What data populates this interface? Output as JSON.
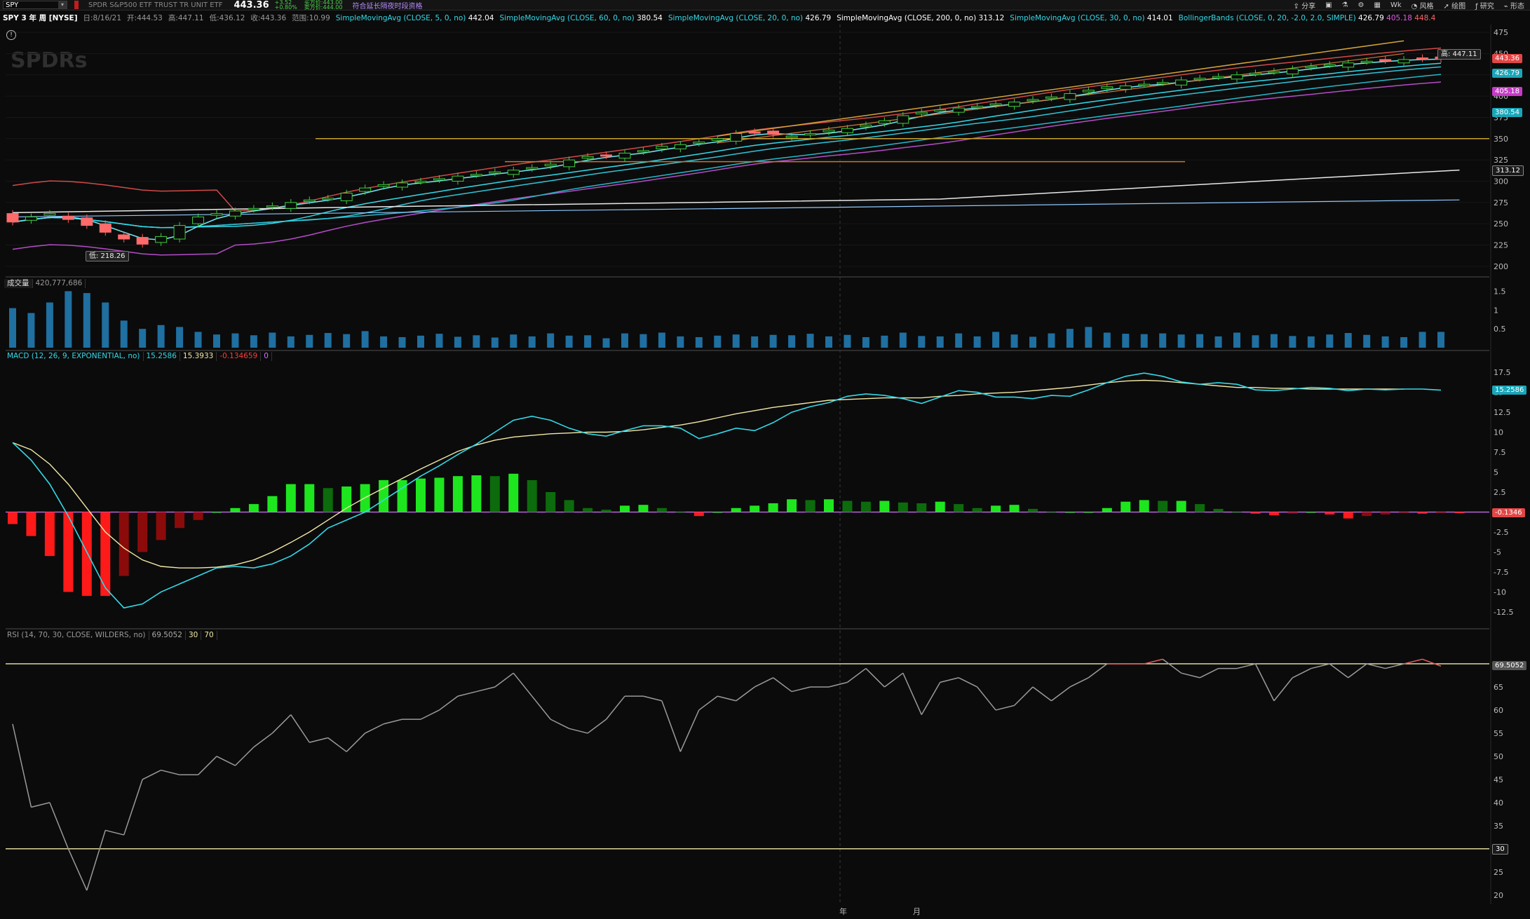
{
  "topbar": {
    "symbol": "SPY",
    "description": "SPDR S&P500 ETF TRUST TR UNIT ETF",
    "last": "443.36",
    "change": "+3.52",
    "change_pct": "+0.80%",
    "bid": "买方价:443.00",
    "ask": "卖方价:444.00",
    "extended": "符合延长隔夜时段资格",
    "menu": [
      "分享",
      "风格",
      "绘图",
      "研究",
      "形态"
    ]
  },
  "studybar": {
    "title": "SPY 3 年 周 [NYSE]",
    "date": "日:8/16/21",
    "open": "开:444.53",
    "high": "高:447.11",
    "low": "低:436.12",
    "close": "收:443.36",
    "range": "范围:10.99",
    "studies": [
      {
        "name": "SimpleMovingAvg (CLOSE, 5, 0, no)",
        "value": "442.04",
        "color": "#33d9e8"
      },
      {
        "name": "SimpleMovingAvg (CLOSE, 60, 0, no)",
        "value": "380.54",
        "color": "#33d9e8"
      },
      {
        "name": "SimpleMovingAvg (CLOSE, 20, 0, no)",
        "value": "426.79",
        "color": "#33d9e8"
      },
      {
        "name": "SimpleMovingAvg (CLOSE, 200, 0, no)",
        "value": "313.12",
        "color": "#ffffff"
      },
      {
        "name": "SimpleMovingAvg (CLOSE, 30, 0, no)",
        "value": "414.01",
        "color": "#33d9e8"
      },
      {
        "name": "BollingerBands (CLOSE, 0, 20, -2.0, 2.0, SIMPLE)",
        "value": "426.79",
        "value2": "405.18",
        "value3": "448.4",
        "color": "#33d9e8"
      }
    ]
  },
  "watermark": "SPDRs",
  "annotations": {
    "high": "高: 447.11",
    "low": "低: 218.26"
  },
  "price_axis": {
    "ticks": [
      "475",
      "450",
      "425",
      "400",
      "375",
      "350",
      "325",
      "300",
      "275",
      "250",
      "225",
      "200"
    ],
    "boxes": [
      {
        "text": "443.36",
        "value": 443.36,
        "bg": "#e24646"
      },
      {
        "text": "426.79",
        "value": 426.79,
        "bg": "#1aa6b8"
      },
      {
        "text": "405.18",
        "value": 405.18,
        "bg": "#c63bc6"
      },
      {
        "text": "380.54",
        "value": 380.54,
        "bg": "#1aa6b8"
      },
      {
        "text": "313.12",
        "value": 313.12,
        "bg": "#1a1a1a"
      }
    ]
  },
  "volume": {
    "label": "成交量",
    "value": "420,777,686",
    "ticks": [
      "1.5",
      "1",
      "0.5"
    ]
  },
  "macd": {
    "label": "MACD (12, 26, 9, EXPONENTIAL, no)",
    "v1": "15.2586",
    "v2": "15.3933",
    "v3": "-0.134659",
    "v4": "0",
    "ticks": [
      "17.5",
      "15",
      "12.5",
      "10",
      "7.5",
      "5",
      "2.5",
      "0",
      "-2.5",
      "-5",
      "-7.5",
      "-10",
      "-12.5"
    ],
    "boxes": [
      {
        "text": "15.2586",
        "value": 15.2586,
        "bg": "#1aa6b8"
      },
      {
        "text": "-0.1346",
        "value": -0.1346,
        "bg": "#e24646"
      }
    ]
  },
  "rsi": {
    "label": "RSI (14, 70, 30, CLOSE, WILDERS, no)",
    "v1": "69.5052",
    "v2": "30",
    "v3": "70",
    "ticks": [
      "65",
      "60",
      "55",
      "50",
      "45",
      "40",
      "35",
      "25",
      "20"
    ],
    "boxes": [
      {
        "text": "69.5052",
        "value": 69.5052,
        "bg": "#555555"
      },
      {
        "text": "30",
        "value": 30,
        "bg": "#1a1a1a"
      }
    ]
  },
  "time_axis": [
    "年",
    "月"
  ],
  "chart_data": {
    "type": "line",
    "price_range": [
      190,
      480
    ],
    "macd_range": [
      -14,
      19
    ],
    "rsi_range": [
      18,
      75
    ],
    "volume_range": [
      0,
      1.6
    ],
    "sma200": [
      [
        0,
        263
      ],
      [
        20,
        270
      ],
      [
        50,
        279
      ],
      [
        78,
        313.12
      ]
    ],
    "close": [
      252,
      258,
      262,
      255,
      248,
      240,
      232,
      226,
      235,
      248,
      258,
      262,
      265,
      268,
      271,
      275,
      278,
      280,
      286,
      292,
      296,
      298,
      300,
      303,
      306,
      308,
      311,
      313,
      316,
      320,
      325,
      329,
      330,
      333,
      336,
      341,
      343,
      346,
      350,
      356,
      357,
      355,
      353,
      356,
      360,
      362,
      366,
      371,
      377,
      381,
      384,
      386,
      388,
      391,
      393,
      396,
      399,
      403,
      407,
      411,
      412,
      414,
      416,
      419,
      421,
      423,
      425,
      427,
      429,
      432,
      435,
      437,
      439,
      441,
      442,
      443,
      444,
      443.36
    ],
    "volume": [
      1.05,
      0.92,
      1.2,
      1.5,
      1.45,
      1.2,
      0.72,
      0.5,
      0.6,
      0.55,
      0.42,
      0.35,
      0.38,
      0.33,
      0.4,
      0.3,
      0.34,
      0.39,
      0.36,
      0.44,
      0.3,
      0.28,
      0.32,
      0.37,
      0.29,
      0.33,
      0.27,
      0.35,
      0.3,
      0.38,
      0.32,
      0.33,
      0.25,
      0.38,
      0.36,
      0.4,
      0.3,
      0.28,
      0.32,
      0.35,
      0.3,
      0.34,
      0.33,
      0.37,
      0.3,
      0.34,
      0.28,
      0.32,
      0.4,
      0.31,
      0.3,
      0.38,
      0.3,
      0.42,
      0.35,
      0.29,
      0.38,
      0.5,
      0.55,
      0.4,
      0.37,
      0.36,
      0.38,
      0.35,
      0.36,
      0.3,
      0.4,
      0.33,
      0.36,
      0.31,
      0.3,
      0.35,
      0.39,
      0.34,
      0.3,
      0.28,
      0.42,
      0.42
    ],
    "macd": [
      8.7,
      6.5,
      3.5,
      -0.5,
      -5,
      -9.5,
      -12,
      -11.5,
      -10,
      -9,
      -8,
      -7,
      -6.8,
      -7,
      -6.5,
      -5.5,
      -4,
      -2,
      -1,
      0,
      1.5,
      3,
      4.5,
      5.8,
      7.2,
      8.5,
      10,
      11.5,
      12,
      11.5,
      10.5,
      9.8,
      9.5,
      10.2,
      10.8,
      10.8,
      10.5,
      9.2,
      9.8,
      10.5,
      10.2,
      11.2,
      12.5,
      13.2,
      13.7,
      14.5,
      14.8,
      14.6,
      14.2,
      13.6,
      14.4,
      15.2,
      15,
      14.4,
      14.4,
      14.2,
      14.6,
      14.5,
      15.3,
      16.2,
      17,
      17.4,
      17,
      16.3,
      16,
      16.2,
      16,
      15.3,
      15.2,
      15.4,
      15.6,
      15.5,
      15.2,
      15.4,
      15.3,
      15.4,
      15.4,
      15.2586
    ],
    "signal": [
      8.7,
      7.8,
      6,
      3.5,
      0.5,
      -2.5,
      -4.5,
      -6,
      -6.8,
      -7,
      -7,
      -6.9,
      -6.6,
      -6,
      -5,
      -3.8,
      -2.5,
      -1,
      0.5,
      1.8,
      3,
      4.2,
      5.4,
      6.5,
      7.6,
      8.4,
      9,
      9.4,
      9.6,
      9.8,
      9.9,
      10,
      10,
      10.1,
      10.3,
      10.6,
      10.9,
      11.3,
      11.8,
      12.3,
      12.7,
      13.1,
      13.4,
      13.7,
      14,
      14.1,
      14.2,
      14.3,
      14.3,
      14.3,
      14.5,
      14.6,
      14.8,
      14.9,
      15,
      15.2,
      15.4,
      15.6,
      15.9,
      16.2,
      16.4,
      16.5,
      16.4,
      16.2,
      16,
      15.8,
      15.6,
      15.6,
      15.5,
      15.5,
      15.4,
      15.4,
      15.4,
      15.4,
      15.4,
      15.3933
    ],
    "histogram": [
      -1.5,
      -3,
      -5.5,
      -10,
      -10.5,
      -10.5,
      -8,
      -5,
      -3.5,
      -2,
      -1,
      0,
      0.5,
      1,
      2,
      3.5,
      3.5,
      3,
      3.2,
      3.5,
      4,
      4,
      4.2,
      4.3,
      4.5,
      4.6,
      4.5,
      4.8,
      4,
      2.5,
      1.5,
      0.5,
      0.3,
      0.8,
      0.9,
      0.5,
      0,
      -0.5,
      0,
      0.5,
      0.8,
      1.1,
      1.6,
      1.5,
      1.6,
      1.4,
      1.3,
      1.4,
      1.2,
      1.1,
      1.3,
      1.0,
      0.5,
      0.8,
      0.9,
      0.4,
      0,
      0,
      0,
      0.5,
      1.3,
      1.5,
      1.4,
      1.4,
      1.0,
      0.4,
      0,
      -0.2,
      -0.4,
      -0.2,
      0,
      -0.3,
      -0.8,
      -0.5,
      -0.3,
      -0.1,
      -0.2,
      -0.1,
      -0.1347
    ],
    "rsi": [
      57,
      39,
      40,
      30,
      21,
      34,
      33,
      45,
      47,
      46,
      46,
      50,
      48,
      52,
      55,
      59,
      53,
      54,
      51,
      55,
      57,
      58,
      58,
      60,
      63,
      64,
      65,
      68,
      63,
      58,
      56,
      55,
      58,
      63,
      63,
      62,
      51,
      60,
      63,
      62,
      65,
      67,
      64,
      65,
      65,
      66,
      69,
      65,
      68,
      59,
      66,
      67,
      65,
      60,
      61,
      65,
      62,
      65,
      67,
      70,
      70,
      70,
      71,
      68,
      67,
      69,
      69,
      70,
      62,
      67,
      69,
      70,
      67,
      70,
      69,
      70,
      71,
      69.5052
    ]
  }
}
